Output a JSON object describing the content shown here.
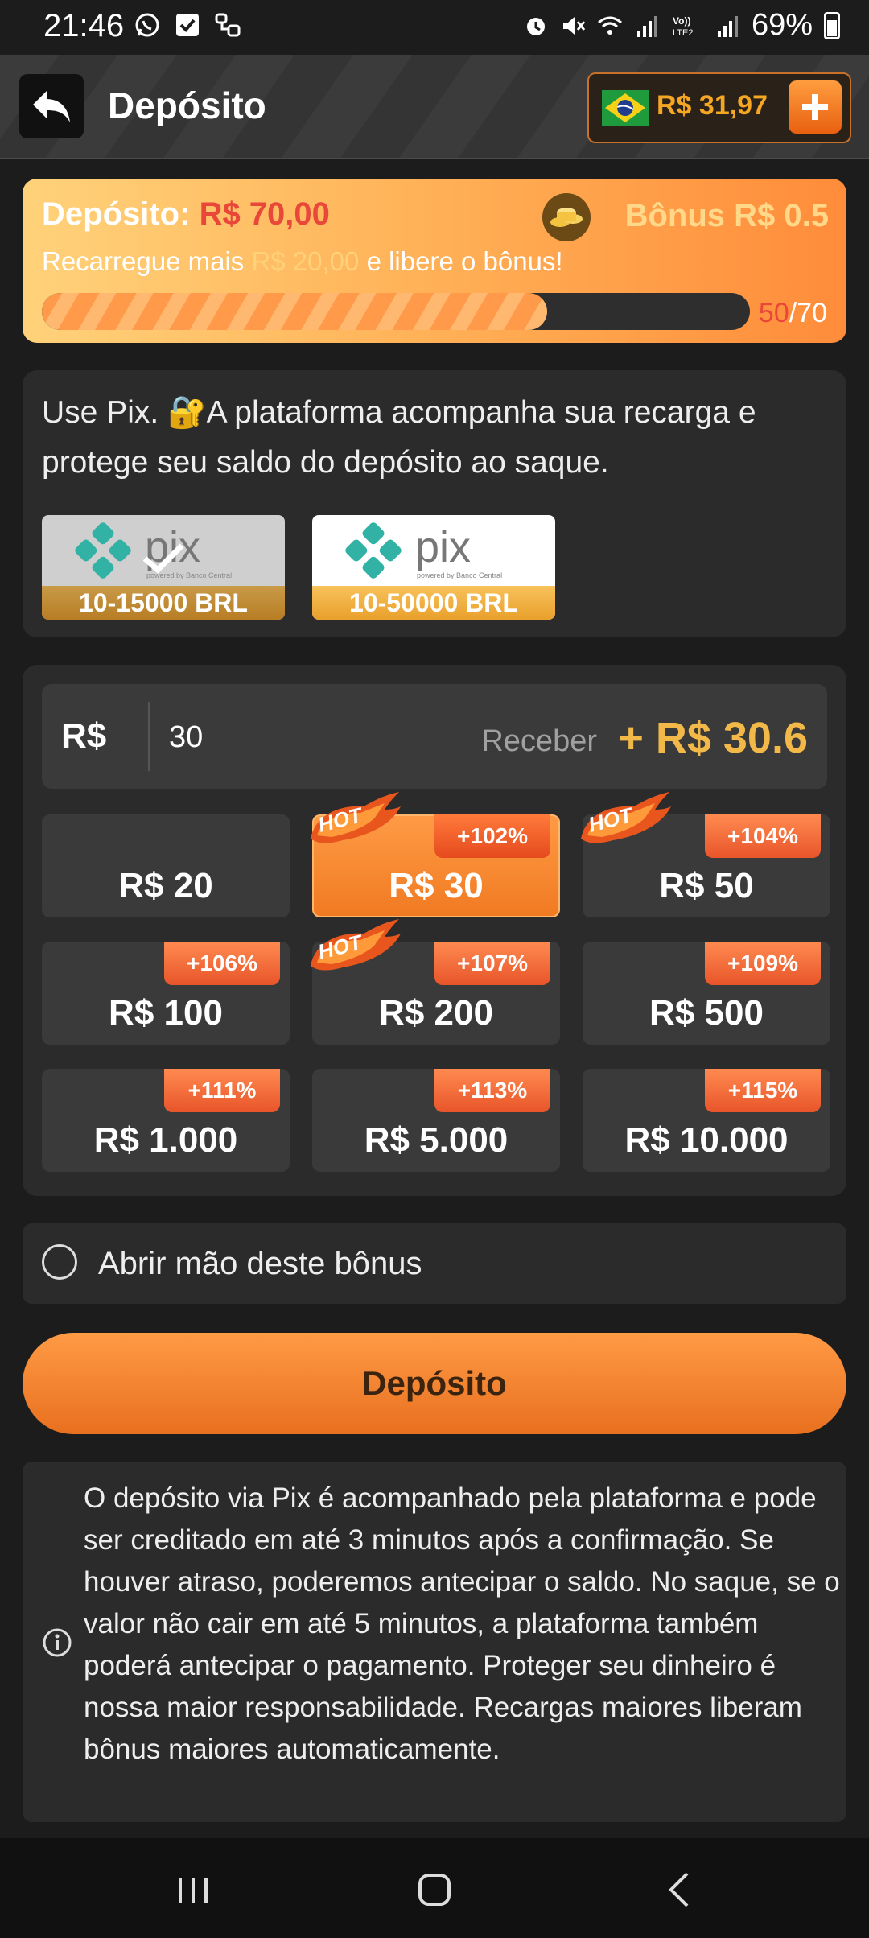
{
  "status_bar": {
    "time": "21:46",
    "battery": "69%",
    "icons": [
      "whatsapp-icon",
      "check-icon",
      "link-icon",
      "alarm-icon",
      "mute-icon",
      "wifi-icon",
      "signal-icon",
      "volte-icon",
      "signal-icon",
      "battery-icon"
    ]
  },
  "header": {
    "title": "Depósito",
    "balance": "R$ 31,97",
    "flag": "brazil-flag-icon"
  },
  "bonus": {
    "deposit_label": "Depósito:",
    "deposit_amount": "R$ 70,00",
    "bonus_label": "Bônus R$ 0.5",
    "recharge_prefix": "Recarregue mais",
    "recharge_amount": "R$ 20,00",
    "recharge_suffix": "e libere o bônus!",
    "progress_current": "50",
    "progress_total": "/70",
    "progress_fraction": 0.714
  },
  "pix": {
    "description": "Use Pix. 🔐A plataforma acompanha sua recarga e protege seu saldo do depósito ao saque.",
    "options": [
      {
        "range": "10-15000 BRL",
        "selected": true
      },
      {
        "range": "10-50000 BRL",
        "selected": false
      }
    ]
  },
  "amount": {
    "currency": "R$",
    "value": "30",
    "receive_label": "Receber",
    "receive_value": "+ R$ 30.6",
    "buttons": [
      {
        "label": "R$ 20",
        "pct": "",
        "hot": false,
        "selected": false
      },
      {
        "label": "R$ 30",
        "pct": "+102%",
        "hot": true,
        "selected": true
      },
      {
        "label": "R$ 50",
        "pct": "+104%",
        "hot": true,
        "selected": false
      },
      {
        "label": "R$ 100",
        "pct": "+106%",
        "hot": false,
        "selected": false
      },
      {
        "label": "R$ 200",
        "pct": "+107%",
        "hot": true,
        "selected": false
      },
      {
        "label": "R$ 500",
        "pct": "+109%",
        "hot": false,
        "selected": false
      },
      {
        "label": "R$ 1.000",
        "pct": "+111%",
        "hot": false,
        "selected": false
      },
      {
        "label": "R$ 5.000",
        "pct": "+113%",
        "hot": false,
        "selected": false
      },
      {
        "label": "R$ 10.000",
        "pct": "+115%",
        "hot": false,
        "selected": false
      }
    ],
    "hot_text": "HOT"
  },
  "waive_bonus": {
    "label": "Abrir mão deste bônus"
  },
  "deposit_button": {
    "label": "Depósito"
  },
  "info": {
    "text": "O depósito via Pix é acompanhado pela plataforma e pode ser creditado em até 3 minutos após a confirmação. Se houver atraso, poderemos antecipar o saldo. No saque, se o valor não cair em até 5 minutos, a plataforma também poderá antecipar o pagamento. Proteger seu dinheiro é nossa maior responsabilidade. Recargas maiores liberam bônus maiores automaticamente."
  },
  "colors": {
    "accent": "#f07a22",
    "gold": "#f3b948",
    "red": "#e8473a",
    "card": "#2b2b2b",
    "background": "#1c1c1c"
  }
}
